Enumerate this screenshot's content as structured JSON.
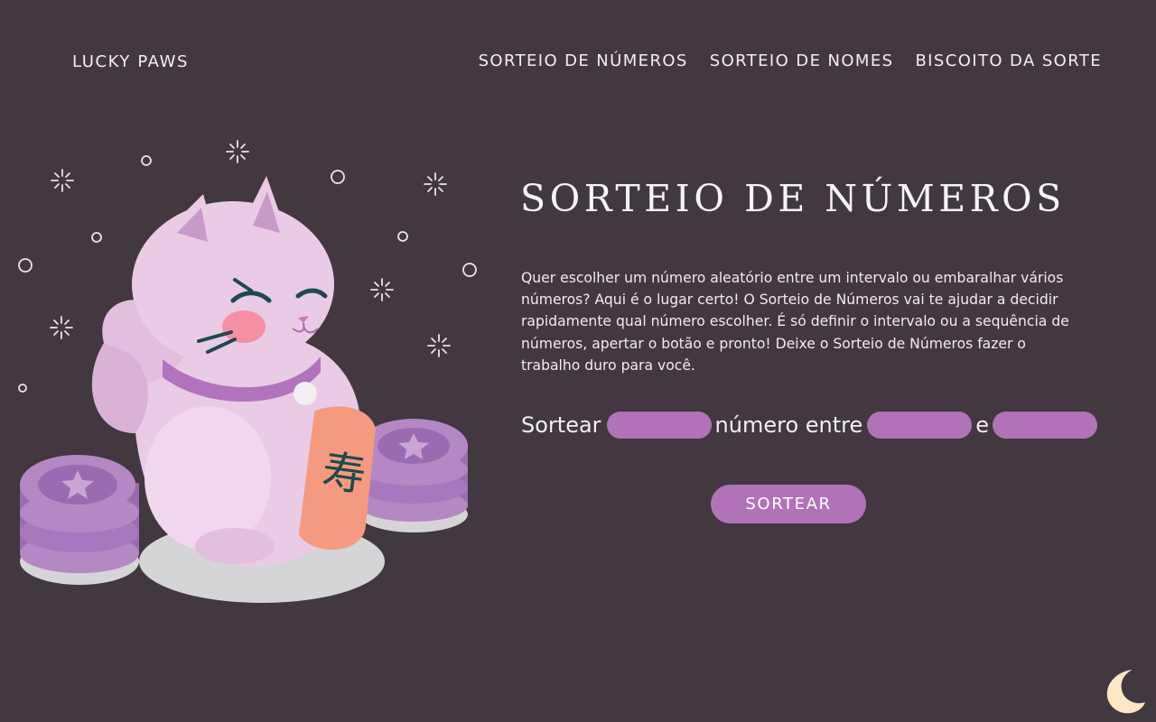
{
  "header": {
    "brand": "LUCKY PAWS",
    "nav": [
      {
        "label": "SORTEIO DE NÚMEROS"
      },
      {
        "label": "SORTEIO DE NOMES"
      },
      {
        "label": "BISCOITO DA SORTE"
      }
    ]
  },
  "main": {
    "title": "SORTEIO DE NÚMEROS",
    "description": "Quer escolher um número aleatório entre um intervalo ou embaralhar vários números? Aqui é o lugar certo! O Sorteio de Números vai te ajudar a decidir rapidamente qual número escolher. É só definir o intervalo ou a sequência de números, apertar o botão e pronto! Deixe o Sorteio de Números fazer o trabalho duro para você.",
    "form": {
      "prefix": "Sortear",
      "middle": "número entre",
      "conjunction": "e",
      "quantity_value": "",
      "min_value": "",
      "max_value": "",
      "submit_label": "SORTEAR"
    }
  },
  "illustration": {
    "coin_badge_text": "寿"
  },
  "theme_toggle": {
    "icon": "moon-icon"
  },
  "colors": {
    "background": "#413840",
    "accent": "#b172b8",
    "moon": "#fde7c4",
    "cat": "#e9cbe6",
    "coin": "#a778bd"
  }
}
